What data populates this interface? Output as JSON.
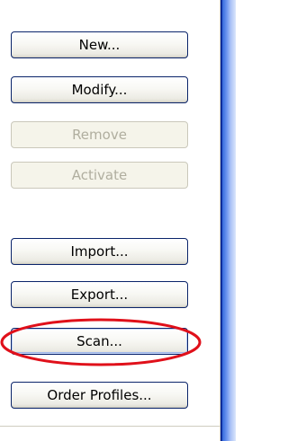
{
  "buttons": {
    "new": "New...",
    "modify": "Modify...",
    "remove": "Remove",
    "activate": "Activate",
    "import": "Import...",
    "export": "Export...",
    "scan": "Scan...",
    "order_profiles": "Order Profiles..."
  },
  "state": {
    "remove_enabled": false,
    "activate_enabled": false,
    "scan_highlighted": true
  },
  "colors": {
    "button_border": "#0a246a",
    "disabled_text": "#b0ae9f",
    "highlight_ring": "#e0101a",
    "window_edge": "#3f72e0"
  }
}
